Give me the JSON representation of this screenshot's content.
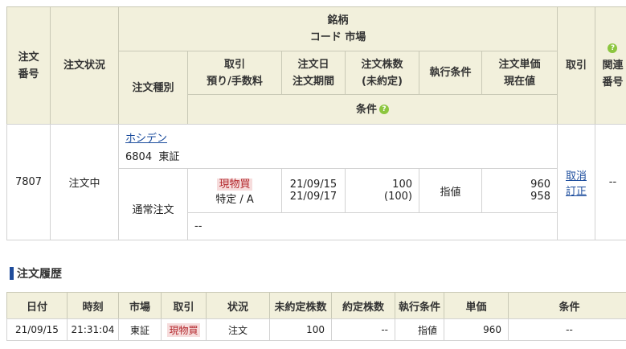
{
  "orders_table": {
    "header": {
      "order_no": [
        "注文",
        "番号"
      ],
      "order_status": "注文状況",
      "brand": [
        "銘柄",
        "コード  市場"
      ],
      "order_type": "注文種別",
      "trade": [
        "取引",
        "預り/手数料"
      ],
      "order_date": [
        "注文日",
        "注文期間"
      ],
      "quantity": [
        "注文株数",
        "(未約定)"
      ],
      "execution": "執行条件",
      "price": [
        "注文単価",
        "現在値"
      ],
      "action": "取引",
      "related": [
        "関連",
        "番号"
      ],
      "condition": "条件"
    },
    "row": {
      "order_no": "7807",
      "order_status": "注文中",
      "brand_name": "ホシデン",
      "brand_code_market": "6804  東証",
      "order_type": "通常注文",
      "trade_type": "現物買",
      "account": "特定 / A",
      "order_date": "21/09/15",
      "order_period": "21/09/17",
      "quantity": "100",
      "unexecuted": "(100)",
      "execution": "指値",
      "unit_price": "960",
      "current_price": "958",
      "cancel_link": "取消",
      "modify_link": "訂正",
      "related": "--",
      "condition": "--"
    }
  },
  "history": {
    "title": "注文履歴",
    "columns": [
      "日付",
      "時刻",
      "市場",
      "取引",
      "状況",
      "未約定株数",
      "約定株数",
      "執行条件",
      "単価",
      "条件"
    ],
    "rows": [
      [
        "21/09/15",
        "21:31:04",
        "東証",
        "現物買",
        "注文",
        "100",
        "--",
        "指値",
        "960",
        "--"
      ]
    ]
  },
  "icons": {
    "help": "question-circle-icon",
    "accent": "#8cc63f",
    "header_bg": "#f2f0dc"
  }
}
